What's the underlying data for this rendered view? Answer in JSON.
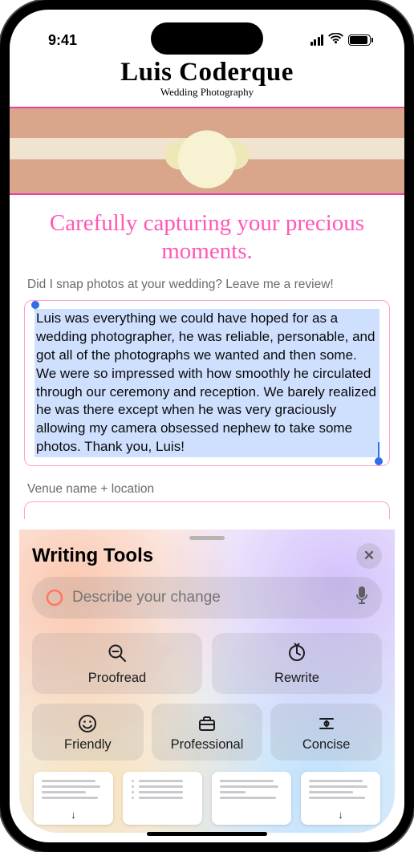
{
  "status": {
    "time": "9:41"
  },
  "header": {
    "brand": "Luis Coderque",
    "subtitle": "Wedding Photography"
  },
  "page": {
    "tagline": "Carefully capturing your precious moments.",
    "review_prompt": "Did I snap photos at your wedding? Leave me a review!",
    "review_text": "Luis was everything we could have hoped for as a wedding photographer, he was reliable, personable, and got all of the photographs we wanted and then some. We were so impressed with how smoothly he circulated through our ceremony and reception. We barely realized he was there except when he was very graciously allowing my camera obsessed nephew to take some photos. Thank you, Luis!",
    "venue_label": "Venue name + location"
  },
  "panel": {
    "title": "Writing Tools",
    "input_placeholder": "Describe your change",
    "buttons": {
      "proofread": "Proofread",
      "rewrite": "Rewrite",
      "friendly": "Friendly",
      "professional": "Professional",
      "concise": "Concise"
    }
  }
}
